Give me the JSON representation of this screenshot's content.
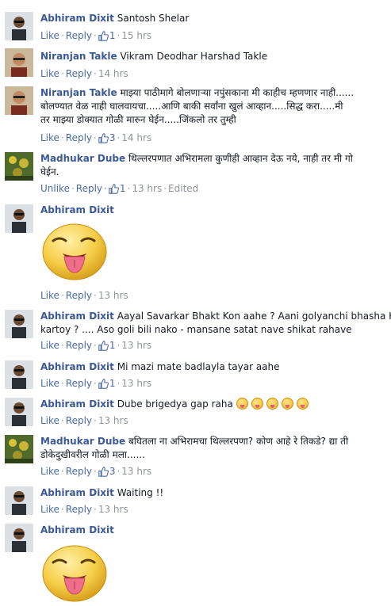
{
  "comments": [
    {
      "author": "Abhiram Dixit",
      "text": "Santosh Shelar",
      "actions": {
        "like": "Like",
        "reply": "Reply",
        "likes": "1",
        "time": "15 hrs"
      }
    },
    {
      "author": "Niranjan Takle",
      "text": "Vikram Deodhar Harshad Takle",
      "actions": {
        "like": "Like",
        "reply": "Reply",
        "time": "14 hrs"
      }
    },
    {
      "author": "Niranjan Takle",
      "text1": "माझ्या पाठीमागे बोलणाऱ्या नपुंसकाना मी काहीच म्हणणार नाही......",
      "text2": "बोलण्यात वेळ नाही घालवायचा.....आणि बाकी सर्वांना खुलं आव्हान.....सिद्ध करा.....मी",
      "text3": "तर माझ्या डोक्यात गोळी मारुन घेईन.....जिंकलो तर तुम्ही",
      "actions": {
        "like": "Like",
        "reply": "Reply",
        "likes": "3",
        "time": "14 hrs"
      }
    },
    {
      "author": "Madhukar Dube",
      "text1": "थिल्लरपणात अभिरामला कुणीही आव्हान देऊ नये, नाही तर मी गो",
      "text2": "घेईन.",
      "actions": {
        "like": "Unlike",
        "reply": "Reply",
        "likes": "1",
        "time": "13 hrs",
        "edited": "Edited"
      }
    },
    {
      "author": "Abhiram Dixit",
      "actions": {
        "like": "Like",
        "reply": "Reply",
        "time": "13 hrs"
      }
    },
    {
      "author": "Abhiram Dixit",
      "text1": "Aayal Savarkar Bhakt Kon aahe ? Aani golyanchi bhasha Ko",
      "text2": "kartoy ? .... Aso goli bili nako - mansane satat nave shikat rahave",
      "actions": {
        "like": "Like",
        "reply": "Reply",
        "likes": "1",
        "time": "13 hrs"
      }
    },
    {
      "author": "Abhiram Dixit",
      "text": "Mi mazi mate badlayla tayar aahe",
      "actions": {
        "like": "Like",
        "reply": "Reply",
        "likes": "1",
        "time": "13 hrs"
      }
    },
    {
      "author": "Abhiram Dixit",
      "text": "Dube brigedya gap raha",
      "actions": {
        "like": "Like",
        "reply": "Reply",
        "time": "13 hrs"
      }
    },
    {
      "author": "Madhukar Dube",
      "text1": "बघितला ना अभिरामचा थिल्लरपणा? कोण आहे रे तिकडे? द्या ती",
      "text2": "डोकेदुखीवरील गोळी मला......",
      "actions": {
        "like": "Like",
        "reply": "Reply",
        "likes": "3",
        "time": "13 hrs"
      }
    },
    {
      "author": "Abhiram Dixit",
      "text": "Waiting !!",
      "actions": {
        "like": "Like",
        "reply": "Reply",
        "time": "13 hrs"
      }
    },
    {
      "author": "Abhiram Dixit"
    }
  ],
  "colors": {
    "author": "#3b5998",
    "link": "#4b6aa4",
    "meta": "#90949c",
    "emoji": "#f5c33b"
  }
}
